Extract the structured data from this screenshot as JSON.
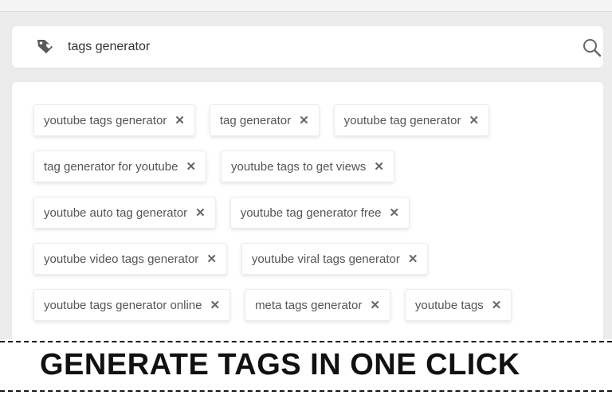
{
  "search": {
    "value": "tags generator",
    "logo_icon": "tag-logo-icon",
    "search_icon": "magnifier-icon"
  },
  "tags": [
    [
      "youtube tags generator",
      "tag generator",
      "youtube tag generator"
    ],
    [
      "tag generator for youtube",
      "youtube tags to get views"
    ],
    [
      "youtube auto tag generator",
      "youtube tag generator free"
    ],
    [
      "youtube video tags generator",
      "youtube viral tags generator"
    ],
    [
      "youtube tags generator online",
      "meta tags generator",
      "youtube tags"
    ]
  ],
  "remove_glyph": "✕",
  "banner": {
    "title": "GENERATE TAGS IN ONE CLICK"
  }
}
